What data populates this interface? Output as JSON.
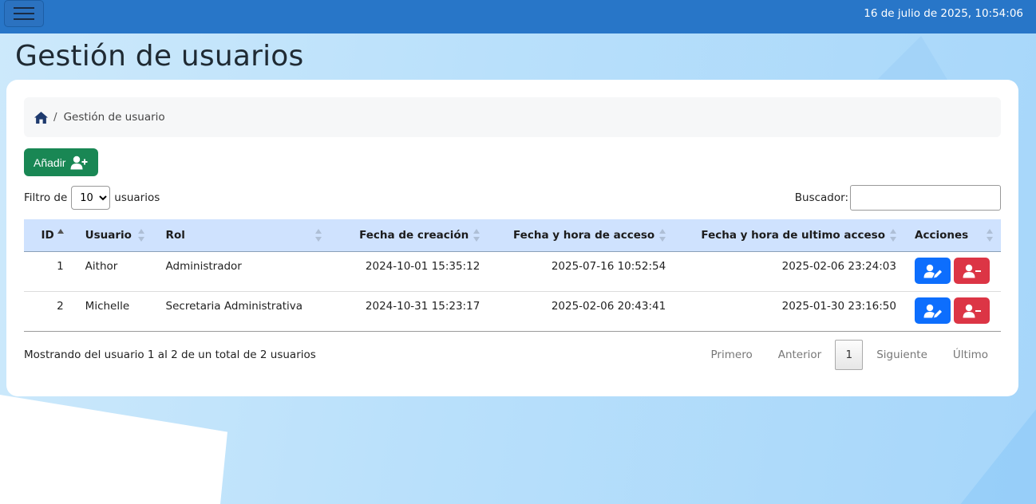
{
  "header": {
    "datetime": "16 de julio de 2025, 10:54:06"
  },
  "page": {
    "title": "Gestión de usuarios"
  },
  "breadcrumb": {
    "current": "Gestión de usuario",
    "separator": "/"
  },
  "toolbar": {
    "add_label": "Añadir"
  },
  "filter": {
    "prefix": "Filtro de",
    "selected": "10",
    "suffix": "usuarios"
  },
  "search": {
    "label": "Buscador:",
    "value": ""
  },
  "table": {
    "columns": [
      "ID",
      "Usuario",
      "Rol",
      "Fecha de creación",
      "Fecha y hora de acceso",
      "Fecha y hora de ultimo acceso",
      "Acciones"
    ],
    "rows": [
      {
        "id": "1",
        "usuario": "Aithor",
        "rol": "Administrador",
        "creacion": "2024-10-01 15:35:12",
        "acceso": "2025-07-16 10:52:54",
        "ultimo": "2025-02-06 23:24:03"
      },
      {
        "id": "2",
        "usuario": "Michelle",
        "rol": "Secretaria Administrativa",
        "creacion": "2024-10-31 15:23:17",
        "acceso": "2025-02-06 20:43:41",
        "ultimo": "2025-01-30 23:16:50"
      }
    ]
  },
  "footer": {
    "info": "Mostrando del usuario 1 al 2 de un total de 2 usuarios"
  },
  "pagination": {
    "first": "Primero",
    "prev": "Anterior",
    "current": "1",
    "next": "Siguiente",
    "last": "Último"
  },
  "colors": {
    "topbar": "#2876c8",
    "add_button": "#198754",
    "edit_button": "#0d6efd",
    "delete_button": "#dc3545",
    "table_header": "#cfe2fe"
  }
}
